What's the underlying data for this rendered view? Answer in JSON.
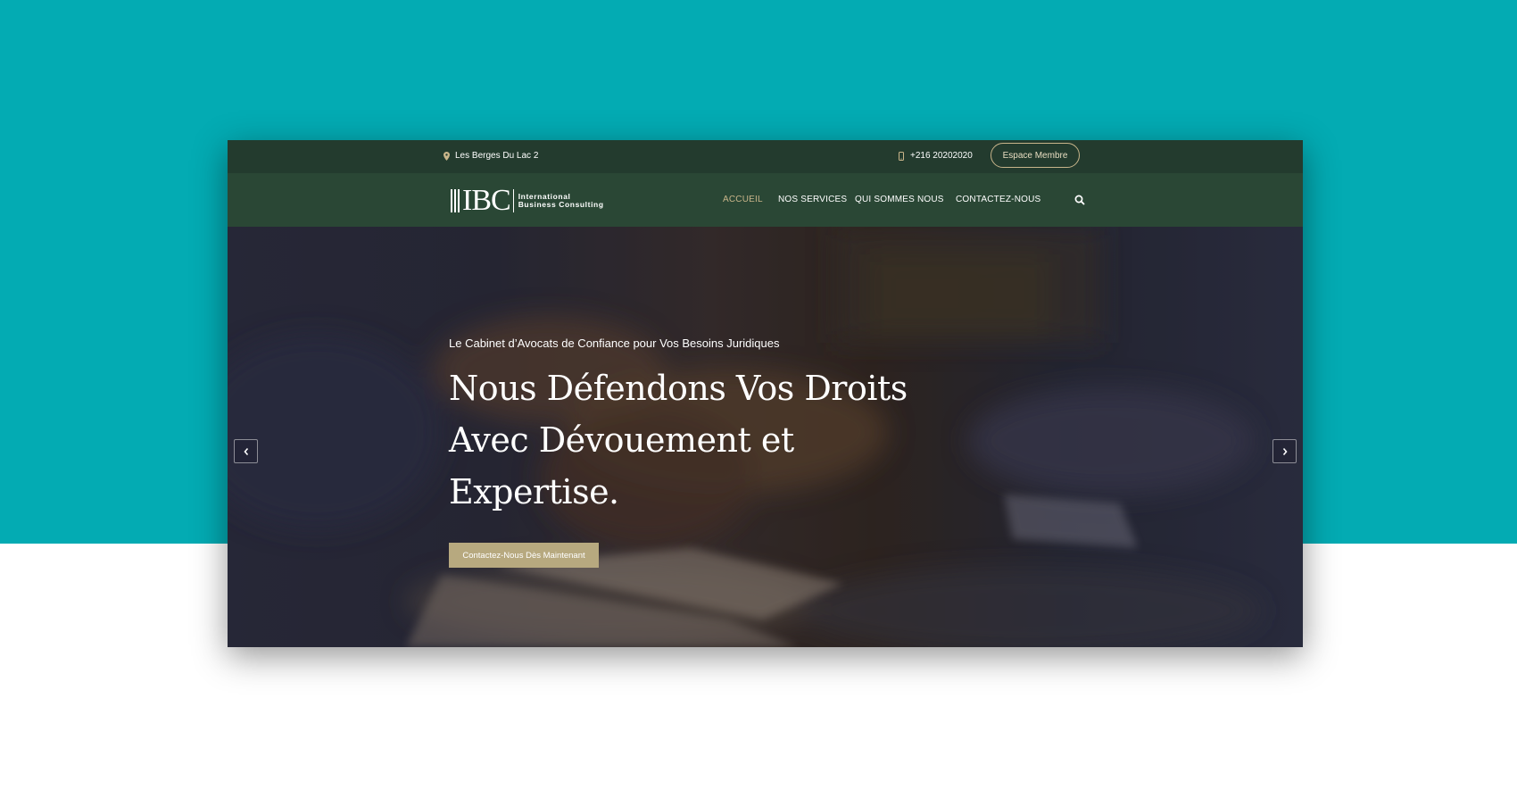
{
  "topbar": {
    "location": "Les Berges Du Lac 2",
    "phone": "+216 20202020",
    "member_button": "Espace Membre"
  },
  "logo": {
    "mark": "IBC",
    "line1": "International",
    "line2": "Business Consulting"
  },
  "nav": {
    "items": [
      {
        "label": "ACCUEIL",
        "active": true
      },
      {
        "label": "NOS SERVICES",
        "active": false
      },
      {
        "label": "QUI SOMMES NOUS",
        "active": false
      },
      {
        "label": "CONTACTEZ-NOUS",
        "active": false
      }
    ]
  },
  "hero": {
    "subtitle": "Le Cabinet d’Avocats de Confiance pour Vos Besoins Juridiques",
    "headline": "Nous Défendons Vos Droits Avec Dévouement et Expertise.",
    "cta": "Contactez-Nous Dès Maintenant"
  },
  "icons": [
    "map-pin-icon",
    "phone-icon",
    "search-icon",
    "chevron-left-icon",
    "chevron-right-icon"
  ],
  "colors": {
    "teal_background": "#03abb3",
    "topbar": "#233b2e",
    "navbar": "#2a4735",
    "accent_gold": "#c9b58a",
    "cta": "#b7a97f"
  }
}
